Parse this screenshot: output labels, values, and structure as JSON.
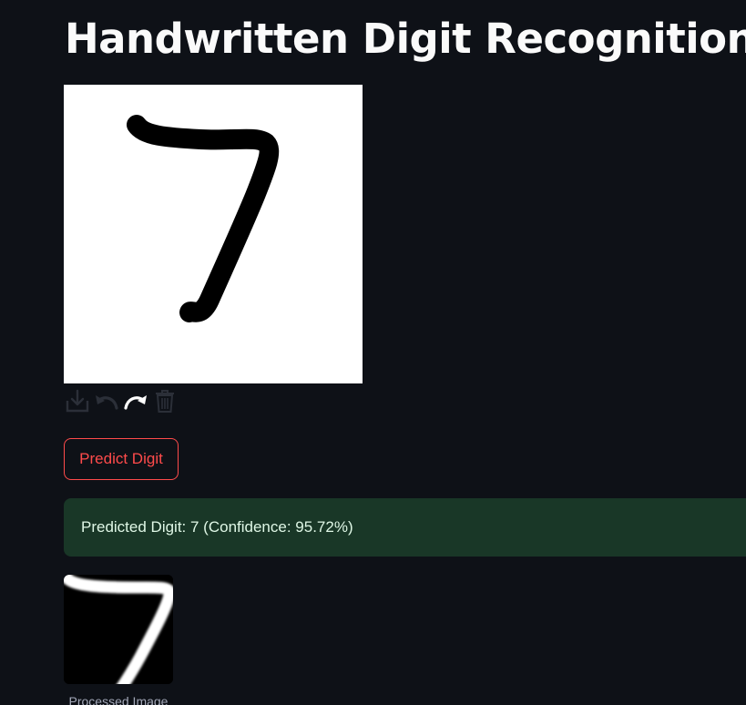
{
  "app": {
    "title": "Handwritten Digit Recognition"
  },
  "canvas_toolbar": {
    "icons": [
      "download-icon",
      "undo-icon",
      "redo-icon",
      "trash-icon"
    ]
  },
  "actions": {
    "predict_label": "Predict Digit"
  },
  "result": {
    "message": "Predicted Digit: 7 (Confidence: 95.72%)"
  },
  "processed_image": {
    "caption": "Processed Image"
  },
  "colors": {
    "background": "#0e1117",
    "accent": "#ff4b4b",
    "success_bg": "#193727",
    "success_text": "#dff7e6"
  }
}
